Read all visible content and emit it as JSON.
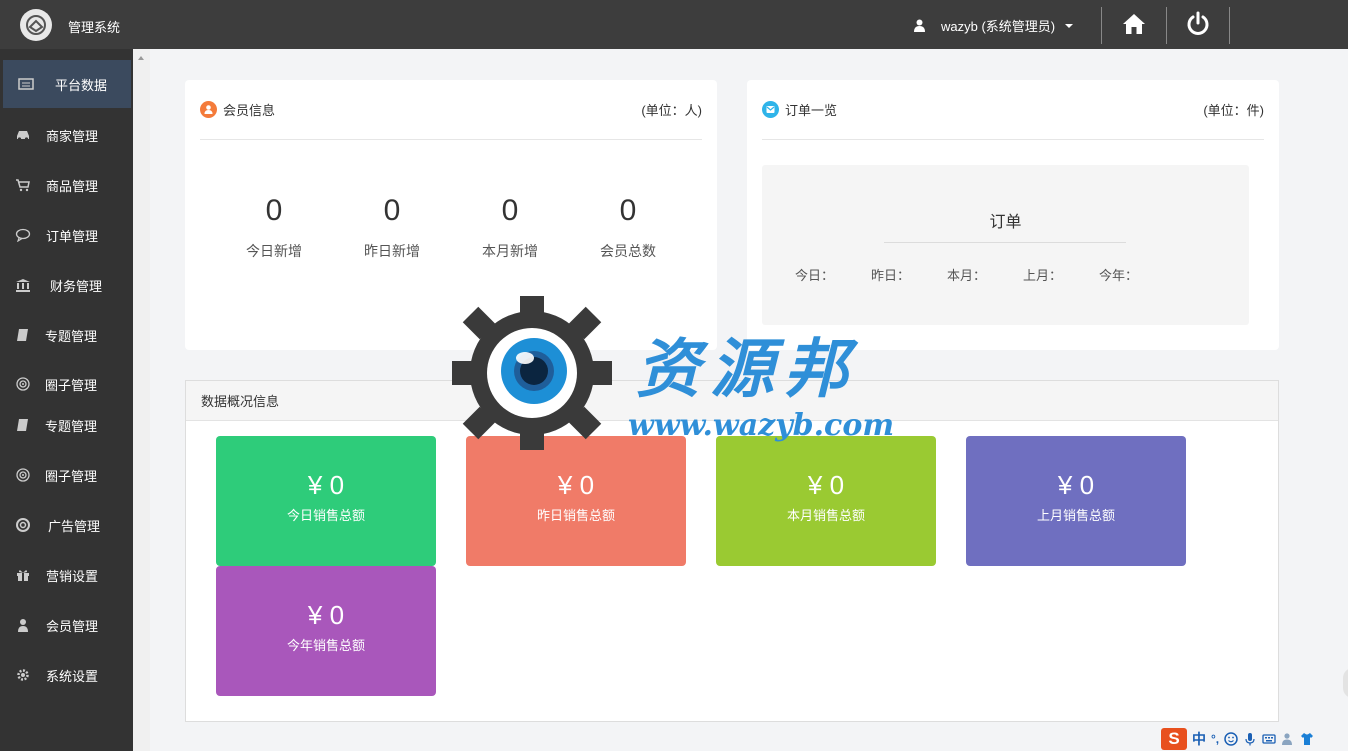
{
  "header": {
    "app_title": "管理系统",
    "user_label": "wazyb (系统管理员)",
    "icons": [
      "logo-icon",
      "user-icon",
      "home-icon",
      "power-icon"
    ]
  },
  "sidebar": {
    "items": [
      {
        "label": "平台数据",
        "icon": "dashboard-icon",
        "active": true
      },
      {
        "label": "商家管理",
        "icon": "car-icon"
      },
      {
        "label": "商品管理",
        "icon": "cart-icon"
      },
      {
        "label": "订单管理",
        "icon": "comment-icon"
      },
      {
        "label": "财务管理",
        "icon": "bank-icon"
      },
      {
        "label": "专题管理",
        "icon": "book-icon"
      },
      {
        "label": "圈子管理",
        "icon": "target-icon"
      },
      {
        "label": "专题管理",
        "icon": "book-icon"
      },
      {
        "label": "圈子管理",
        "icon": "target-icon"
      },
      {
        "label": "广告管理",
        "icon": "lifebuoy-icon"
      },
      {
        "label": "营销设置",
        "icon": "gift-icon"
      },
      {
        "label": "会员管理",
        "icon": "user-icon"
      },
      {
        "label": "系统设置",
        "icon": "gear-icon"
      }
    ]
  },
  "member_card": {
    "title": "会员信息",
    "unit": "(单位：人)",
    "stats": [
      {
        "value": "0",
        "label": "今日新增"
      },
      {
        "value": "0",
        "label": "昨日新增"
      },
      {
        "value": "0",
        "label": "本月新增"
      },
      {
        "value": "0",
        "label": "会员总数"
      }
    ]
  },
  "order_card": {
    "title": "订单一览",
    "unit": "(单位：件)",
    "panel_title": "订单",
    "periods": [
      "今日：",
      "昨日：",
      "本月：",
      "上月：",
      "今年："
    ]
  },
  "overview": {
    "title": "数据概况信息",
    "tiles": [
      {
        "amount": "¥ 0",
        "label": "今日销售总额",
        "color": "#2ecc7a"
      },
      {
        "amount": "¥ 0",
        "label": "昨日销售总额",
        "color": "#f07b68"
      },
      {
        "amount": "¥ 0",
        "label": "本月销售总额",
        "color": "#9aca32"
      },
      {
        "amount": "¥ 0",
        "label": "上月销售总额",
        "color": "#6f6fc0"
      },
      {
        "amount": "¥ 0",
        "label": "今年销售总额",
        "color": "#a957bb"
      }
    ]
  },
  "watermark": {
    "text": "资源邦",
    "url": "www.wazyb.com"
  },
  "ime": {
    "logo": "S",
    "lang": "中",
    "punct": "°,"
  },
  "colors": {
    "topbar": "#3d3d3d",
    "sidebar": "#333333",
    "active_item": "#3b4a5e",
    "member_badge": "#f47b3a",
    "order_badge": "#2fb4e9"
  }
}
